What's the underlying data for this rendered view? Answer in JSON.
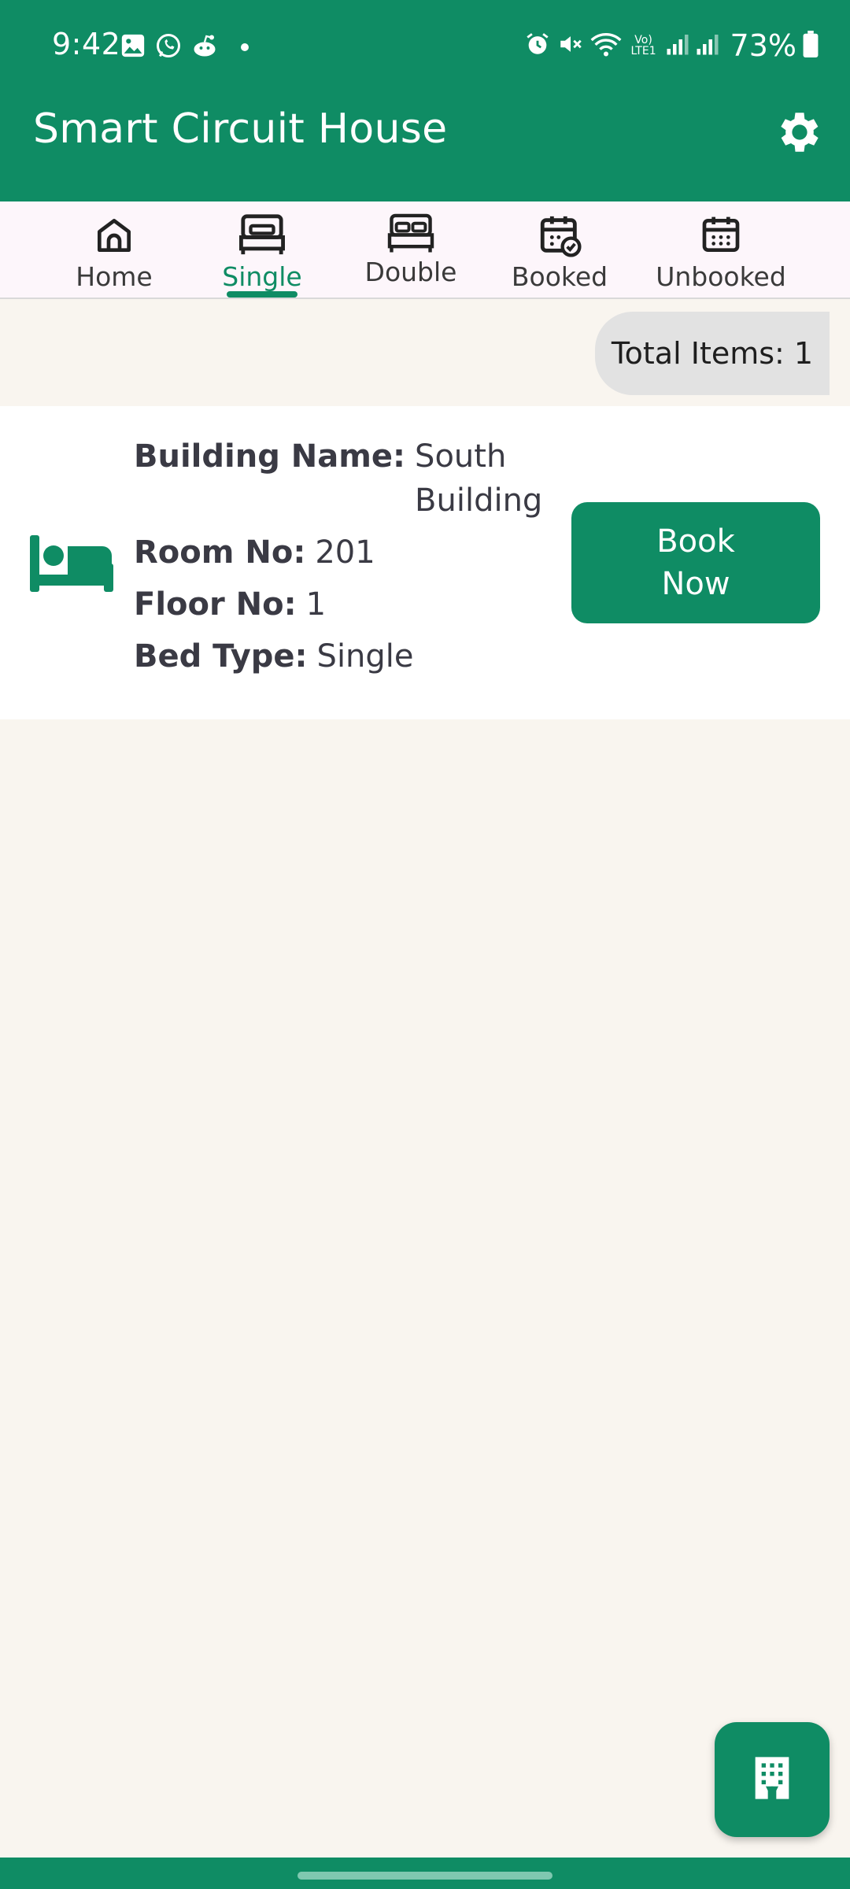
{
  "status_bar": {
    "time": "9:42",
    "battery": "73%",
    "left_icons": [
      "image-icon",
      "whatsapp-icon",
      "reddit-icon",
      "dot-icon"
    ],
    "right_icons": [
      "alarm-icon",
      "mute-icon",
      "wifi-icon",
      "volte-icon",
      "signal-icon",
      "signal-icon",
      "battery-icon"
    ],
    "volte_label": "Vo) LTE1"
  },
  "app_bar": {
    "title": "Smart Circuit House",
    "settings_icon": "gear-icon"
  },
  "tabs": [
    {
      "label": "Home",
      "icon": "home-icon",
      "active": false
    },
    {
      "label": "Single",
      "icon": "single-bed-icon",
      "active": true
    },
    {
      "label": "Double",
      "icon": "double-bed-icon",
      "active": false
    },
    {
      "label": "Booked",
      "icon": "calendar-check-icon",
      "active": false
    },
    {
      "label": "Unbooked",
      "icon": "calendar-icon",
      "active": false
    }
  ],
  "summary": {
    "total_items": "Total Items: 1"
  },
  "rooms": [
    {
      "building_label": "Building Name:",
      "building_value": "South Building",
      "room_label": "Room No:",
      "room_value": "201",
      "floor_label": "Floor No:",
      "floor_value": "1",
      "bed_label": "Bed Type:",
      "bed_value": "Single",
      "button_label": "Book Now",
      "icon": "bed-icon"
    }
  ],
  "fab": {
    "icon": "building-icon"
  },
  "colors": {
    "primary": "#0f8c64",
    "background": "#f9f5ef",
    "tab_bar": "#fdf6fb",
    "chip": "#e2e2e2"
  }
}
